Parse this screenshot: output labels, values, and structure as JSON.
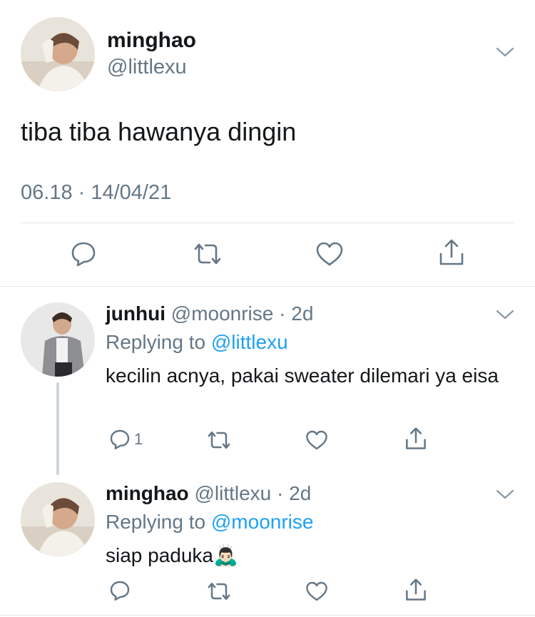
{
  "main_tweet": {
    "name": "minghao",
    "handle": "@littlexu",
    "text": "tiba tiba hawanya dingin",
    "timestamp": "06.18 · 14/04/21"
  },
  "replies": [
    {
      "name": "junhui",
      "handle": "@moonrise",
      "time": "· 2d",
      "replying_label": "Replying to",
      "replying_to": "@littlexu",
      "text": "kecilin acnya, pakai sweater dilemari ya eisa",
      "reply_count": "1"
    },
    {
      "name": "minghao",
      "handle": "@littlexu",
      "time": "· 2d",
      "replying_label": "Replying to",
      "replying_to": "@moonrise",
      "text": "siap paduka🙇🏻‍♂️",
      "reply_count": ""
    }
  ],
  "icons": {
    "reply": "reply-icon",
    "retweet": "retweet-icon",
    "like": "like-icon",
    "share": "share-icon",
    "menu": "chevron-down-icon"
  },
  "colors": {
    "text": "#14171a",
    "secondary": "#657786",
    "link": "#1da1f2",
    "divider": "#e1e8ed"
  }
}
